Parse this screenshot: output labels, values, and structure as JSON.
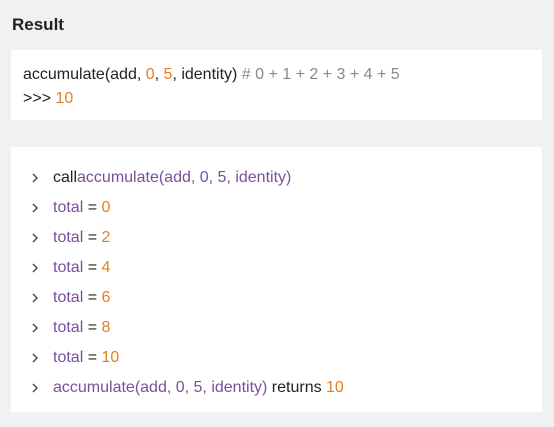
{
  "heading": "Result",
  "result": {
    "line1": {
      "func": "accumulate(add, ",
      "arg0": "0",
      "sep1": ", ",
      "arg1": "5",
      "rest": ", identity) ",
      "comment": "# 0 + 1 + 2 + 3 + 4 + 5"
    },
    "line2": {
      "prompt": ">>> ",
      "value": "10"
    }
  },
  "trace": {
    "call_row": {
      "keyword": "call ",
      "expr": "accumulate(add, 0, 5, identity)"
    },
    "total_rows": [
      {
        "name": "total",
        "op": " = ",
        "value": "0"
      },
      {
        "name": "total",
        "op": " = ",
        "value": "2"
      },
      {
        "name": "total",
        "op": " = ",
        "value": "4"
      },
      {
        "name": "total",
        "op": " = ",
        "value": "6"
      },
      {
        "name": "total",
        "op": " = ",
        "value": "8"
      },
      {
        "name": "total",
        "op": " = ",
        "value": "10"
      }
    ],
    "return_row": {
      "expr": "accumulate(add, 0, 5, identity)",
      "keyword": " returns ",
      "value": "10"
    }
  },
  "colors": {
    "number": "#e67e22",
    "variable": "#7a4f9c",
    "comment": "#8a8a8a",
    "panel": "#ffffff",
    "background": "#f1f1f1"
  },
  "icons": {
    "row_toggle": "chevron-right-icon"
  }
}
